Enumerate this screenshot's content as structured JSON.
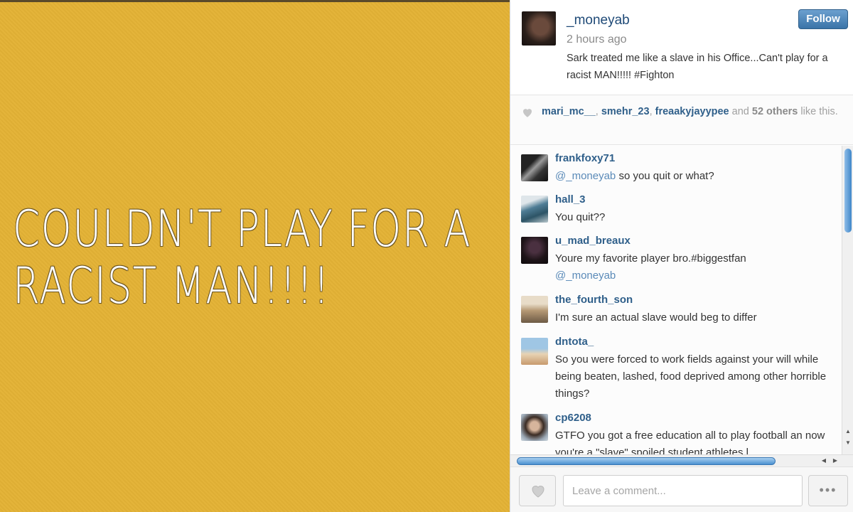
{
  "image": {
    "text_line1": "COULDN'T PLAY FOR A",
    "text_line2": "RACIST MAN!!!!",
    "background_color": "#e3b235"
  },
  "post": {
    "username": "_moneyab",
    "time": "2 hours ago",
    "caption": "Sark treated me like a slave in his Office...Can't play for a racist MAN!!!!! #Fighton",
    "follow_label": "Follow"
  },
  "likes": {
    "user1": "mari_mc__",
    "user2": "smehr_23",
    "user3": "freaakyjayypee",
    "and_text": "and",
    "count": "52 others",
    "suffix": "like this."
  },
  "comments": [
    {
      "username": "frankfoxy71",
      "mention": "@_moneyab",
      "text": " so you quit or what?"
    },
    {
      "username": "hall_3",
      "text": "You quit??"
    },
    {
      "username": "u_mad_breaux",
      "text": "Youre my favorite player bro.#biggestfan",
      "mention_after": "@_moneyab"
    },
    {
      "username": "the_fourth_son",
      "text": "I'm sure an actual slave would beg to differ"
    },
    {
      "username": "dntota_",
      "text": "So you were forced to work fields against your will while being beaten, lashed, food deprived among other horrible things?"
    },
    {
      "username": "cp6208",
      "text": "GTFO you got a free education all to play football an now you're a \"slave\" spoiled student athletes l"
    }
  ],
  "footer": {
    "comment_placeholder": "Leave a comment...",
    "more_label": "•••"
  },
  "colors": {
    "link": "#2f5f8a",
    "follow_button": "#3a74a8"
  }
}
